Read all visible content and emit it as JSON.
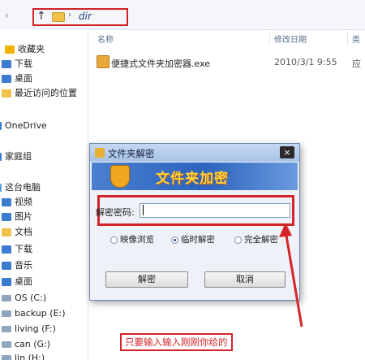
{
  "address": {
    "path": "dir"
  },
  "sidebar": {
    "items": [
      {
        "label": "收藏夹",
        "icon": "star-icon"
      },
      {
        "label": "下载",
        "icon": "download-folder-icon"
      },
      {
        "label": "桌面",
        "icon": "desktop-icon"
      },
      {
        "label": "最近访问的位置",
        "icon": "recent-places-icon"
      },
      {
        "label": "OneDrive",
        "icon": "cloud-icon"
      },
      {
        "label": "家庭组",
        "icon": "homegroup-icon"
      },
      {
        "label": "这台电脑",
        "icon": "computer-icon"
      },
      {
        "label": "视频",
        "icon": "video-folder-icon"
      },
      {
        "label": "图片",
        "icon": "pictures-folder-icon"
      },
      {
        "label": "文档",
        "icon": "documents-folder-icon"
      },
      {
        "label": "下载",
        "icon": "download-folder-icon"
      },
      {
        "label": "音乐",
        "icon": "music-folder-icon"
      },
      {
        "label": "桌面",
        "icon": "desktop-icon"
      },
      {
        "label": "OS (C:)",
        "icon": "drive-icon"
      },
      {
        "label": "backup (E:)",
        "icon": "drive-icon"
      },
      {
        "label": "living (F:)",
        "icon": "drive-icon"
      },
      {
        "label": "can (G:)",
        "icon": "drive-icon"
      },
      {
        "label": "lin (H:)",
        "icon": "drive-icon"
      }
    ]
  },
  "columns": {
    "name": "名称",
    "date": "修改日期",
    "type": "类"
  },
  "files": [
    {
      "name": "便捷式文件夹加密器.exe",
      "date": "2010/3/1 9:55",
      "type": "应"
    }
  ],
  "dialog": {
    "title": "文件夹解密",
    "banner": "文件夹加密",
    "close_label": "×",
    "password_label": "解密密码:",
    "password_value": "",
    "options": [
      {
        "label": "映像浏览",
        "selected": false
      },
      {
        "label": "临时解密",
        "selected": true
      },
      {
        "label": "完全解密",
        "selected": false
      }
    ],
    "decrypt_button": "解密",
    "cancel_button": "取消"
  },
  "annotation": {
    "caption": "只要输入输入刚刚你给的"
  },
  "colors": {
    "highlight_red": "#d3242a",
    "banner_blue": "#2b63bd",
    "banner_text": "#ffd43a"
  }
}
